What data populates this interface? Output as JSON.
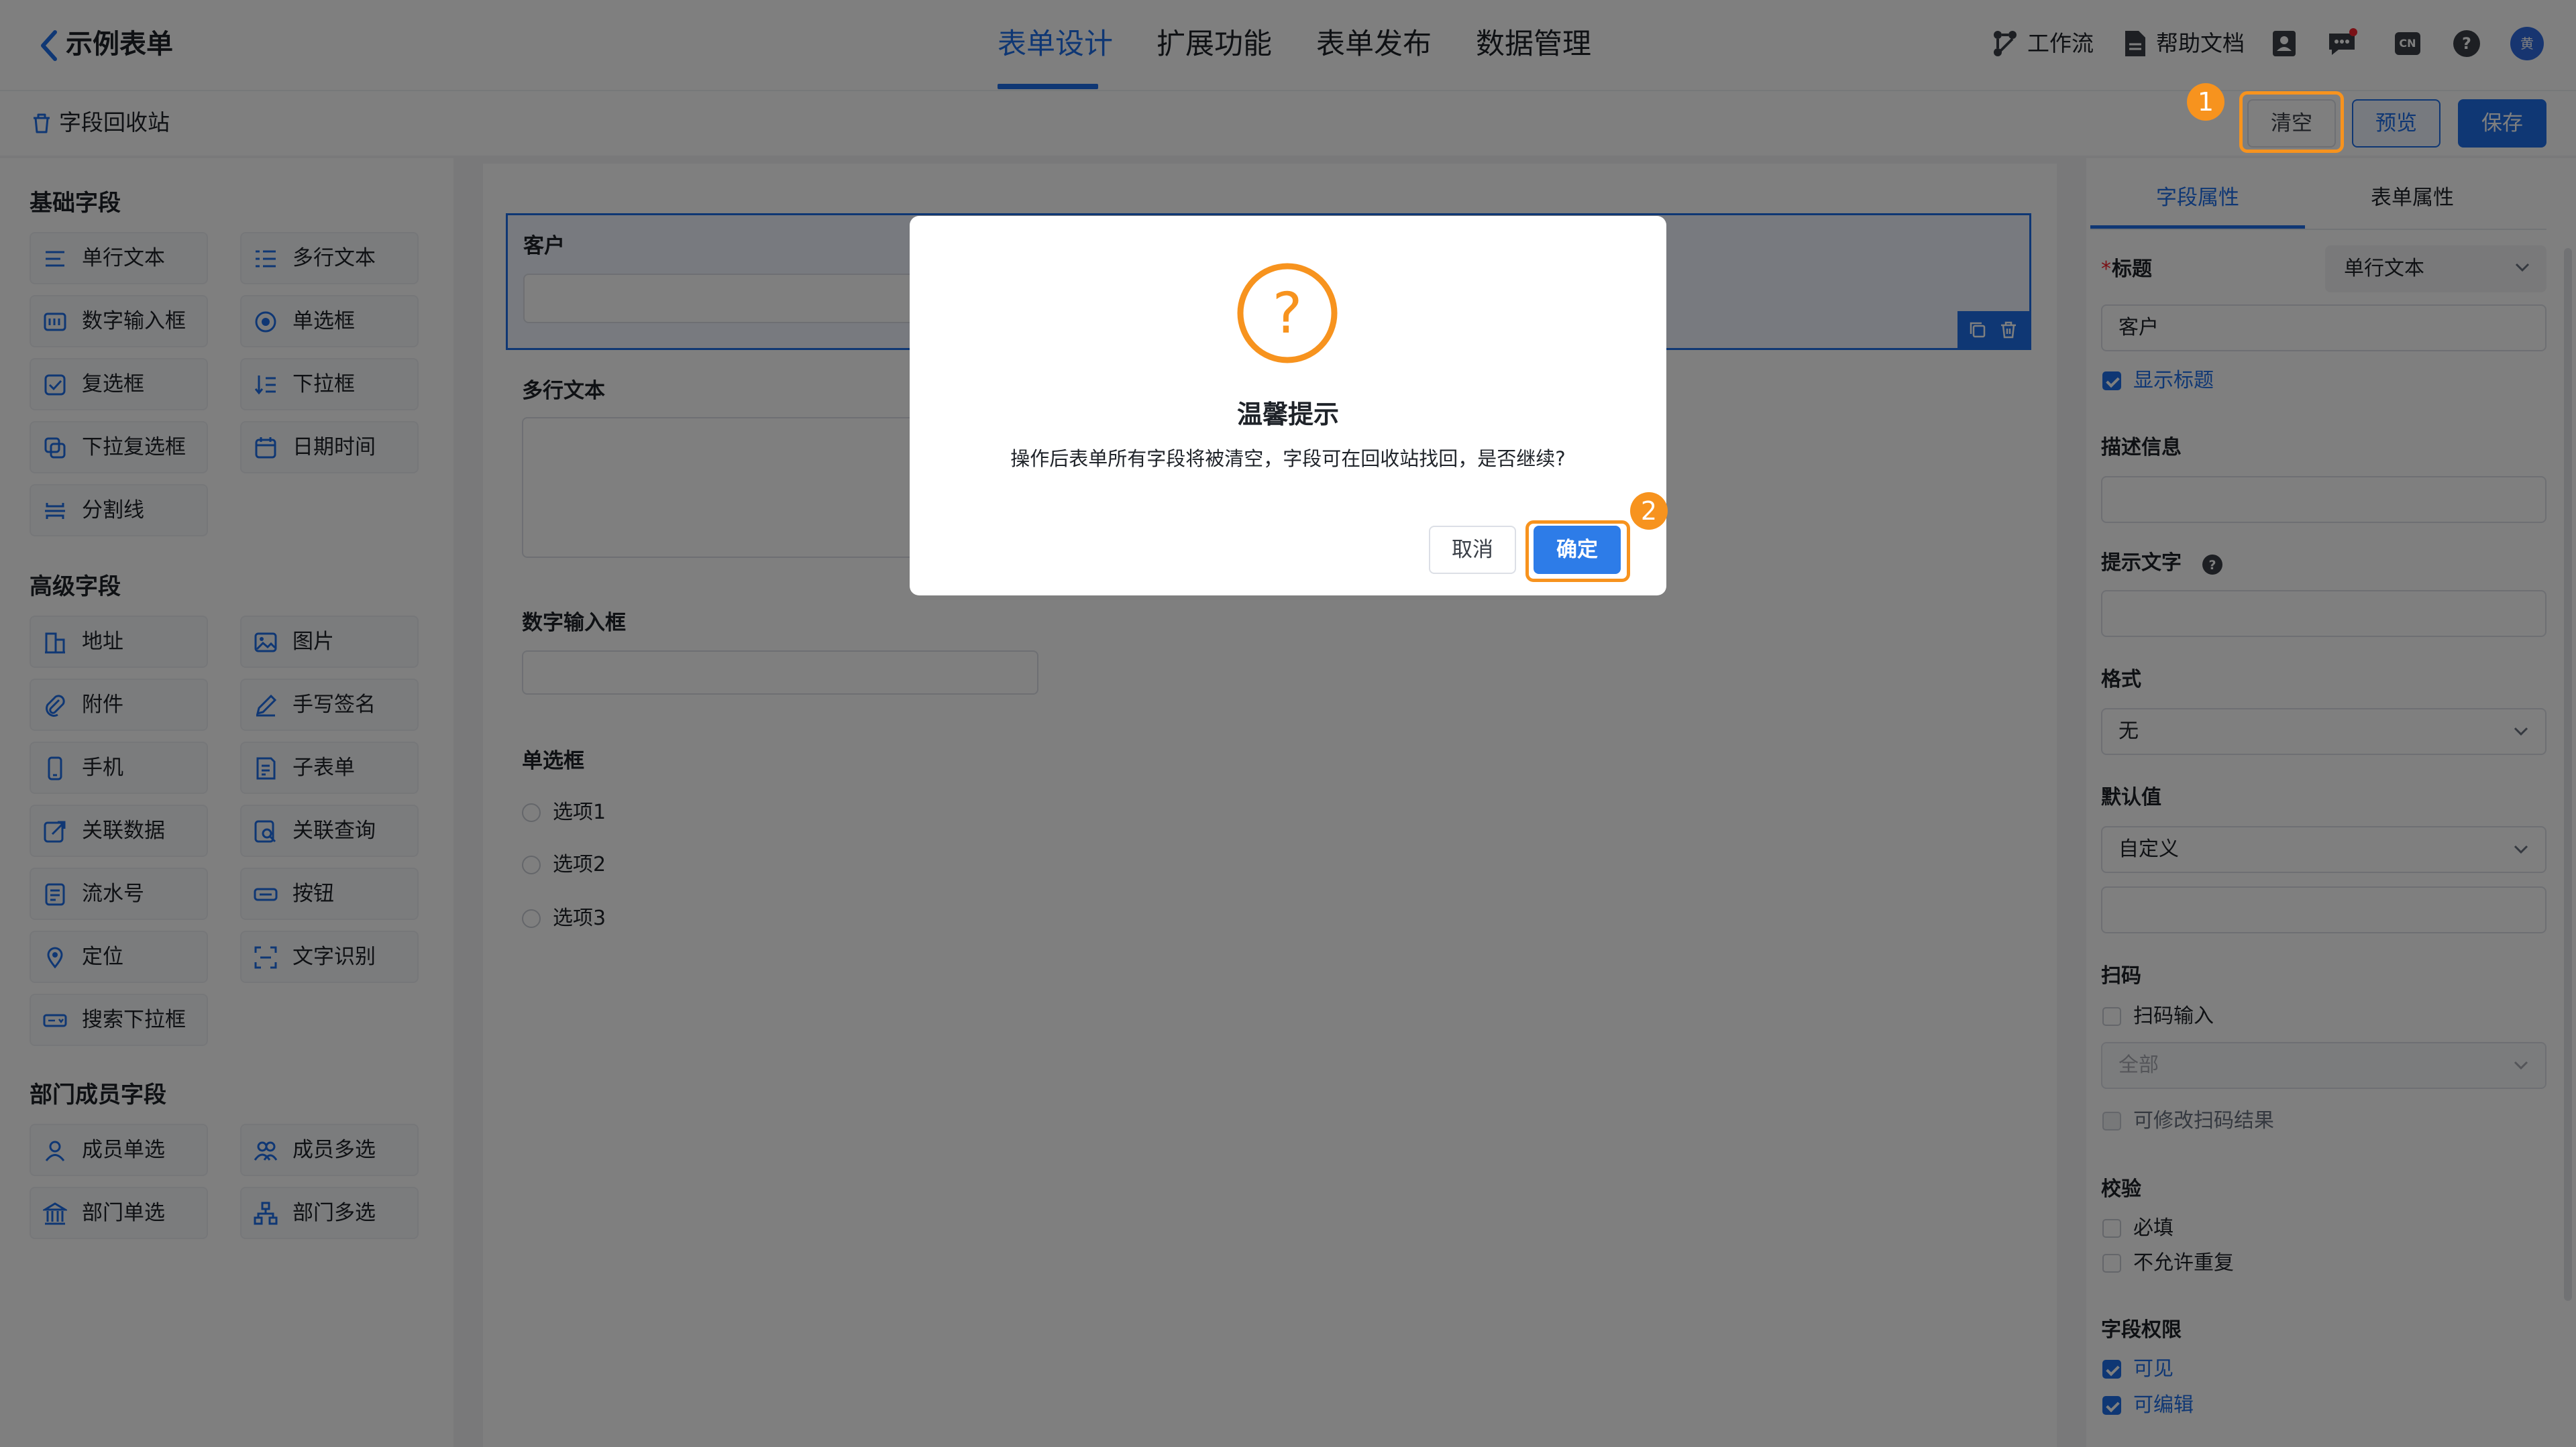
{
  "app": {
    "title": "示例表单"
  },
  "nav": {
    "tabs": [
      {
        "label": "表单设计"
      },
      {
        "label": "扩展功能"
      },
      {
        "label": "表单发布"
      },
      {
        "label": "数据管理"
      }
    ]
  },
  "top_right": {
    "workflow": "工作流",
    "help_docs": "帮助文档",
    "lang": "CN",
    "avatar": "黄"
  },
  "toolbar": {
    "recycle": "字段回收站",
    "clear": "清空",
    "preview": "预览",
    "save": "保存"
  },
  "left_panel": {
    "groups": [
      {
        "title": "基础字段",
        "items": [
          "单行文本",
          "多行文本",
          "数字输入框",
          "单选框",
          "复选框",
          "下拉框",
          "下拉复选框",
          "日期时间",
          "分割线"
        ]
      },
      {
        "title": "高级字段",
        "items": [
          "地址",
          "图片",
          "附件",
          "手写签名",
          "手机",
          "子表单",
          "关联数据",
          "关联查询",
          "流水号",
          "按钮",
          "定位",
          "文字识别",
          "搜索下拉框"
        ]
      },
      {
        "title": "部门成员字段",
        "items": [
          "成员单选",
          "成员多选",
          "部门单选",
          "部门多选"
        ]
      }
    ]
  },
  "canvas": {
    "fields": [
      {
        "label": "客户"
      },
      {
        "label": "多行文本"
      },
      {
        "label": "数字输入框"
      },
      {
        "label": "单选框",
        "options": [
          "选项1",
          "选项2",
          "选项3"
        ]
      }
    ]
  },
  "right_panel": {
    "tabs": [
      "字段属性",
      "表单属性"
    ],
    "title_label": "标题",
    "required_mark": "*",
    "type_select": "单行文本",
    "title_value": "客户",
    "show_title": "显示标题",
    "desc_label": "描述信息",
    "hint_label": "提示文字",
    "format_label": "格式",
    "format_value": "无",
    "default_label": "默认值",
    "default_value": "自定义",
    "scan_label": "扫码",
    "scan_input": "扫码输入",
    "scan_select": "全部",
    "scan_editable": "可修改扫码结果",
    "validate_label": "校验",
    "required": "必填",
    "no_dup": "不允许重复",
    "perm_label": "字段权限",
    "visible": "可见",
    "editable": "可编辑"
  },
  "dialog": {
    "title": "温馨提示",
    "message": "操作后表单所有字段将被清空，字段可在回收站找回，是否继续?",
    "cancel": "取消",
    "confirm": "确定"
  },
  "annotations": [
    "1",
    "2"
  ],
  "colors": {
    "primary": "#1f6fe8",
    "warning": "#f7931e",
    "background": "#f2f3f5"
  }
}
